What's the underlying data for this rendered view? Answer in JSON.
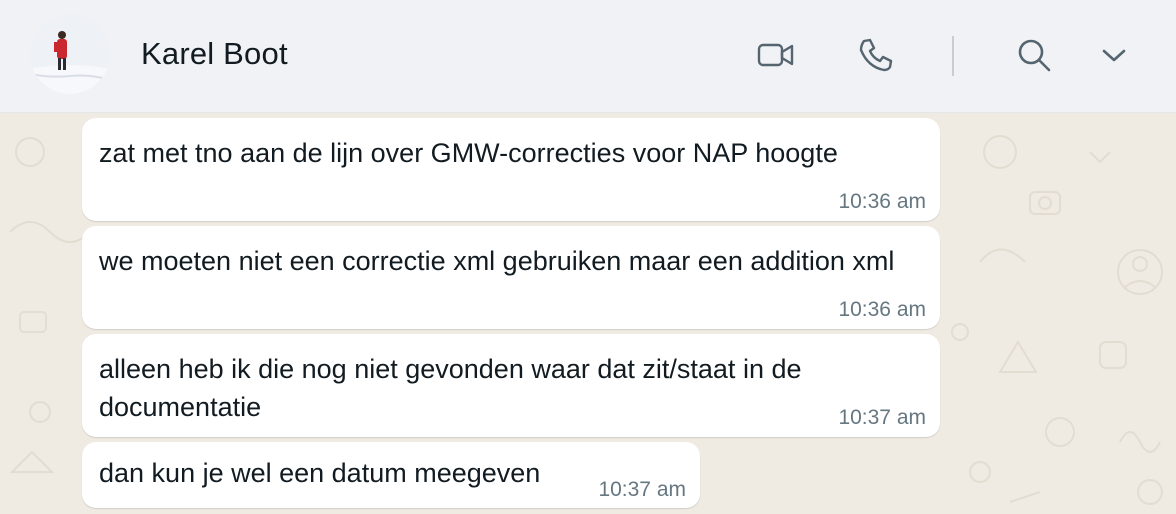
{
  "header": {
    "contact_name": "Karel Boot",
    "icons": [
      "video-call-icon",
      "voice-call-icon",
      "search-icon",
      "chevron-down-icon"
    ]
  },
  "messages": [
    {
      "text": "zat met tno aan de lijn over GMW-correcties voor NAP hoogte",
      "time": "10:36 am"
    },
    {
      "text": "we moeten niet een correctie xml gebruiken maar een addition xml",
      "time": "10:36 am"
    },
    {
      "text": "alleen heb ik die nog niet gevonden waar dat zit/staat in de documentatie",
      "time": "10:37 am"
    },
    {
      "text": "dan kun je wel een datum meegeven",
      "time": "10:37 am"
    }
  ],
  "colors": {
    "header_bg": "#f0f2f5",
    "chat_bg": "#efeae2",
    "bubble_bg": "#ffffff",
    "text": "#111b21",
    "meta": "#667781",
    "icon": "#54656f"
  }
}
